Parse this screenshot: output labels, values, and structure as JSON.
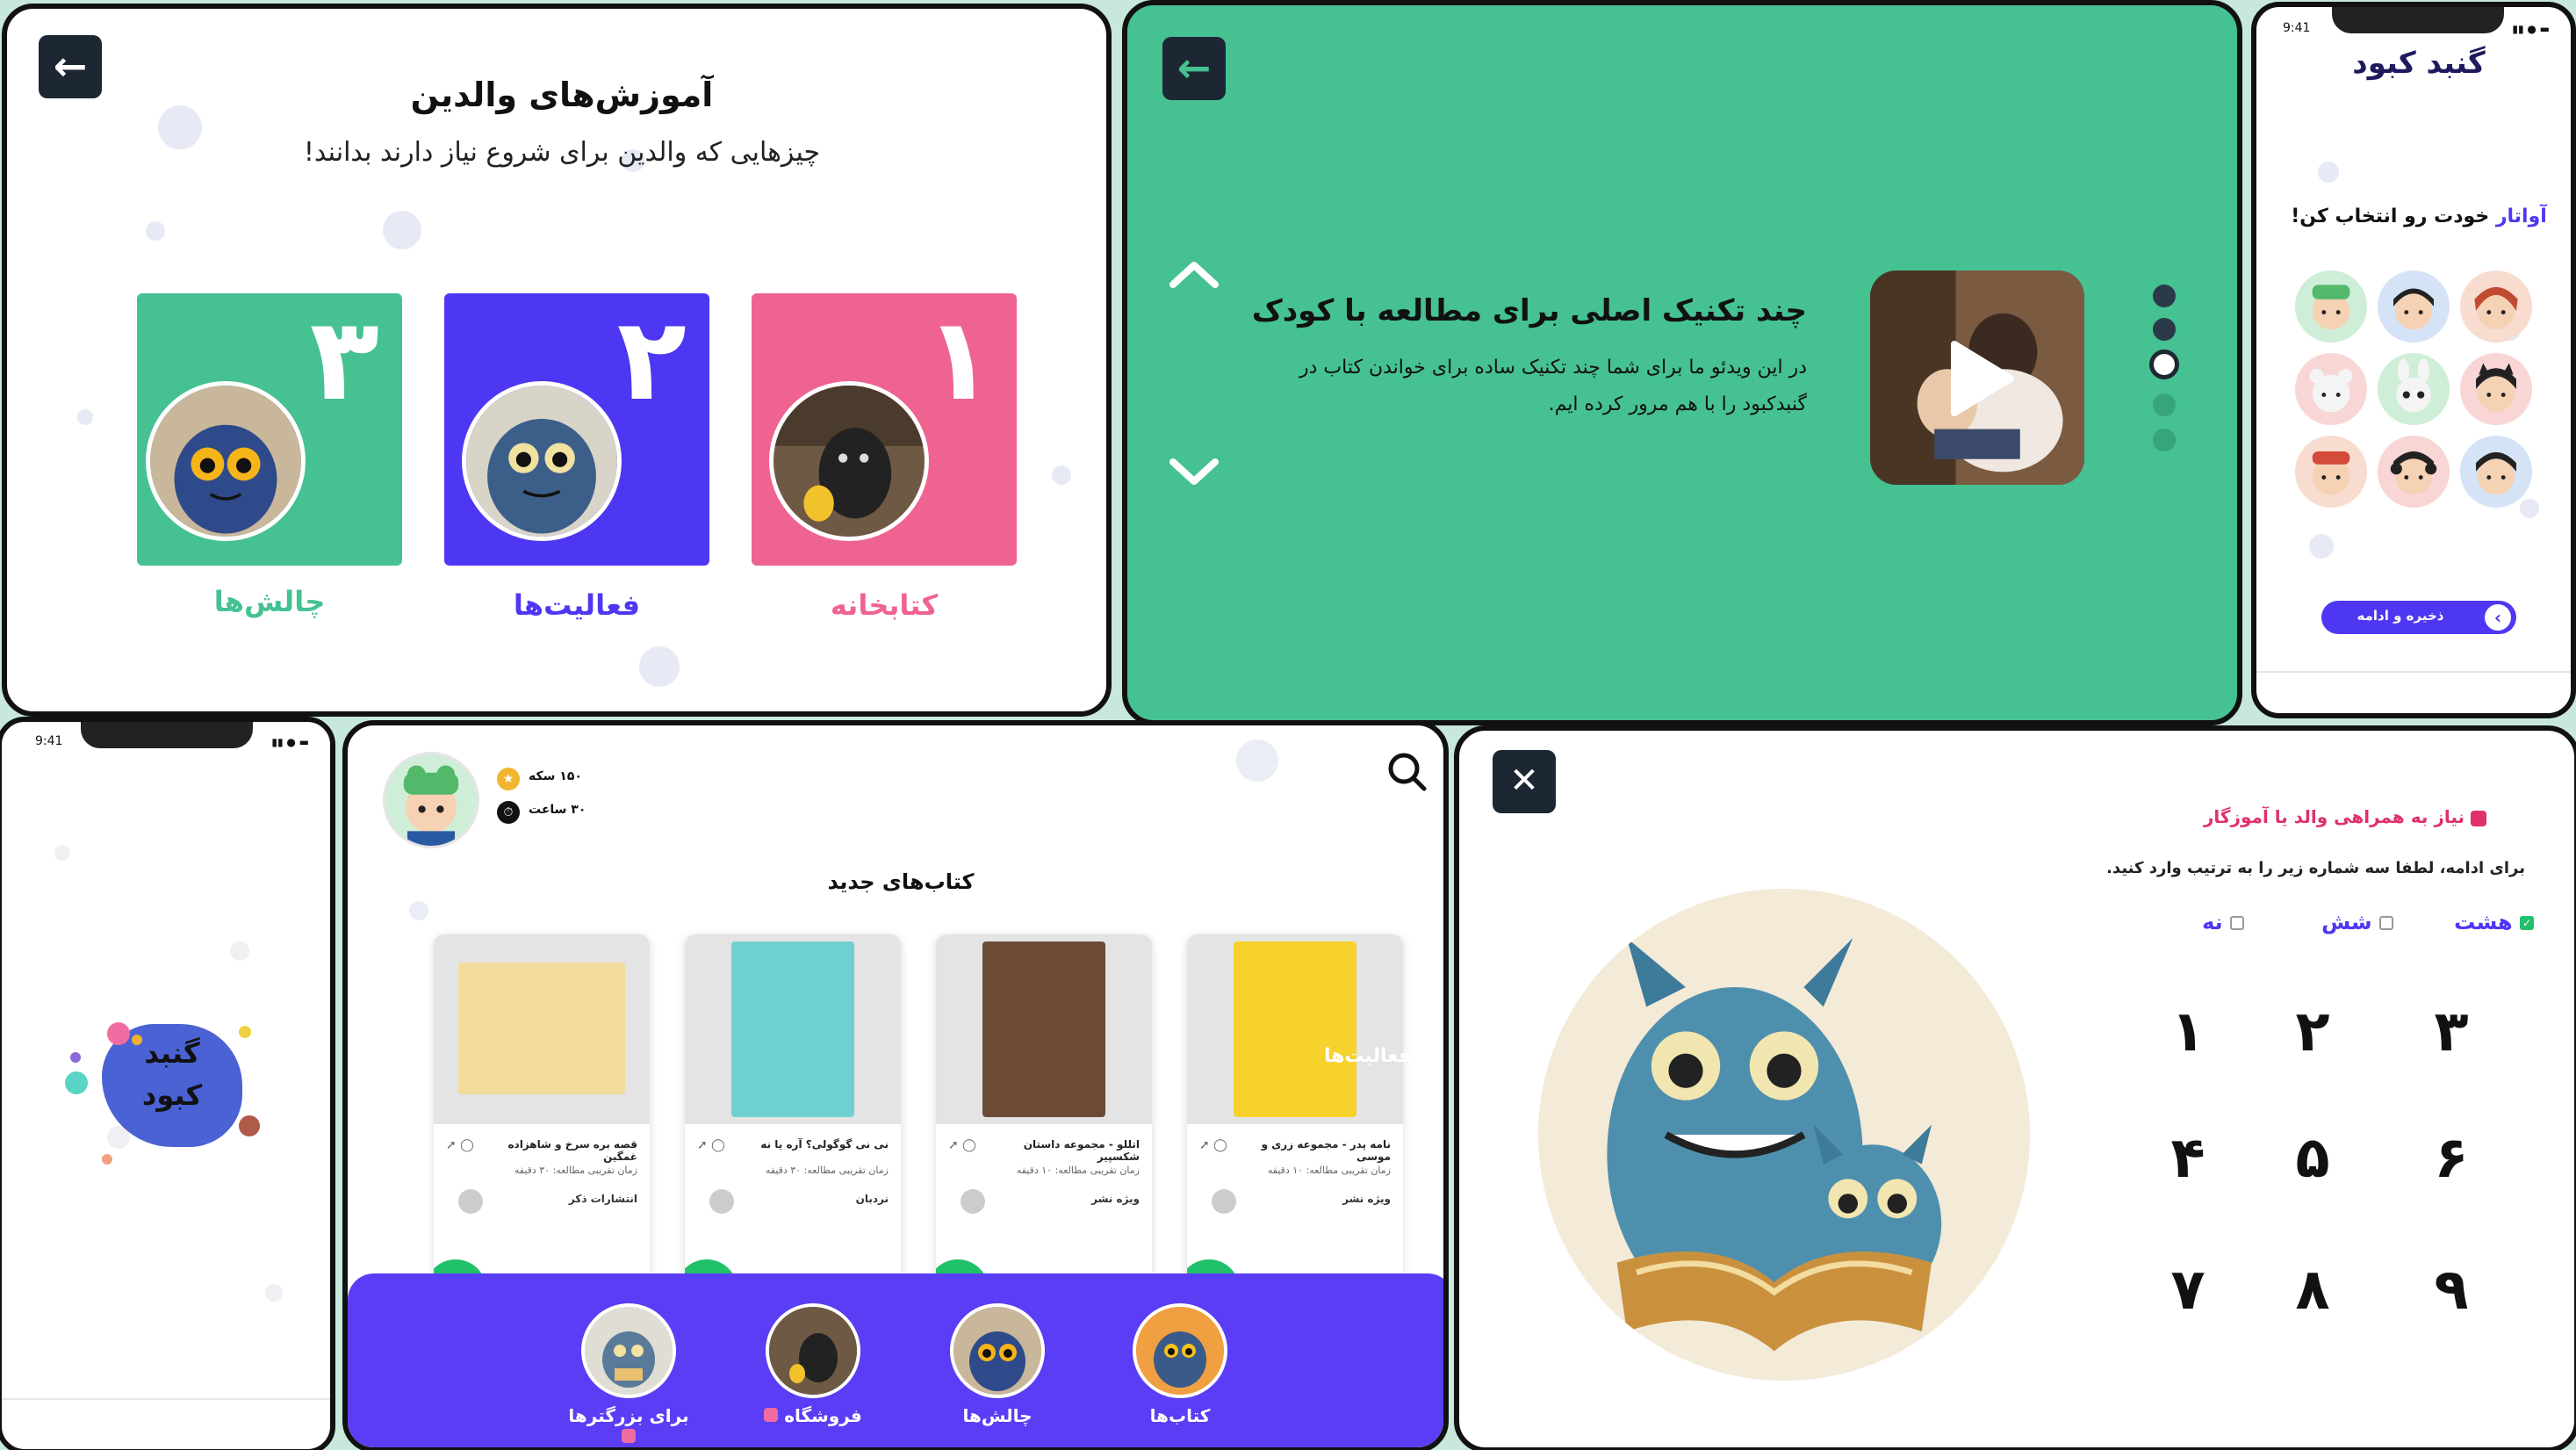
{
  "parents": {
    "title": "آموزش‌های والدین",
    "subtitle": "چیزهایی که والدین برای شروع نیاز دارند بدانند!",
    "back_icon": "arrow-left-icon",
    "cards": [
      {
        "num": "۱",
        "label": "کتابخانه",
        "color": "#ef6390"
      },
      {
        "num": "۲",
        "label": "فعالیت‌ها",
        "color": "#4e37f2"
      },
      {
        "num": "۳",
        "label": "چالش‌ها",
        "color": "#45c192"
      }
    ]
  },
  "video": {
    "title": "چند تکنیک اصلی برای مطالعه با کودک",
    "desc_line1": "در این ویدئو ما برای شما چند تکنیک ساده برای خواندن کتاب در",
    "desc_line2": "گنبدکبود را با هم مرور کرده ایم.",
    "bg": "#45c192"
  },
  "avatar_phone": {
    "time": "9:41",
    "logo": "گنبد کبود",
    "heading_accent": "آواتار",
    "heading_rest": "خودت رو انتخاب کن!",
    "button": "ذخیره و ادامه"
  },
  "splash_phone": {
    "time": "9:41",
    "logo_line1": "گنبد",
    "logo_line2": "کبود"
  },
  "home": {
    "coins": "۱۵۰ سکه",
    "hours": "۳۰ ساعت",
    "section_title": "کتاب‌های جدید",
    "overlay_text": "فعالیت‌ها",
    "books": [
      {
        "title": "نامه پدر - مجموعه زری و موسی",
        "time": "زمان تقریبی مطالعه: ۱۰ دقیقه",
        "publisher": "ویژه نشر",
        "cover": "#f7d22c"
      },
      {
        "title": "اتللو - مجموعه داستان شکسپیر",
        "time": "زمان تقریبی مطالعه: ۱۰ دقیقه",
        "publisher": "ویژه نشر",
        "cover": "#6b4a36"
      },
      {
        "title": "نی نی گوگولی؟ آره یا نه",
        "time": "زمان تقریبی مطالعه: ۳۰ دقیقه",
        "publisher": "نردبان",
        "cover": "#6fd1cf"
      },
      {
        "title": "قصه بره سرخ و شاهزاده غمگین",
        "time": "زمان تقریبی مطالعه: ۳۰ دقیقه",
        "publisher": "انتشارات ذکر",
        "cover": "#f2dc9c"
      }
    ],
    "nav": [
      {
        "label": "کتاب‌ها"
      },
      {
        "label": "چالش‌ها"
      },
      {
        "label": "فروشگاه"
      },
      {
        "label": "برای بزرگترها"
      }
    ]
  },
  "gate": {
    "lock_text": "نیاز به همراهی والد یا آموزگار",
    "instruction": "برای ادامه، لطفا سه شماره زیر را به ترتیب وارد کنید.",
    "words": [
      "هشت",
      "شش",
      "نه"
    ],
    "keys": [
      "۳",
      "۲",
      "۱",
      "۶",
      "۵",
      "۴",
      "۹",
      "۸",
      "۷"
    ],
    "close_icon": "close-icon"
  }
}
